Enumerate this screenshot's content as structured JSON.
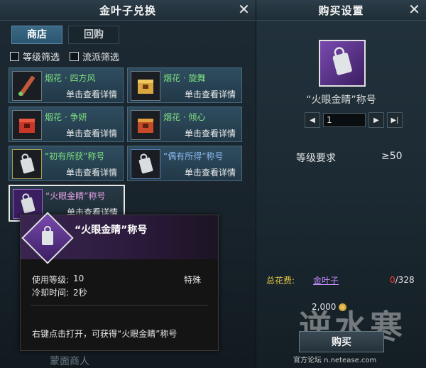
{
  "left": {
    "title": "金叶子兑换",
    "tabs": [
      {
        "label": "商店"
      },
      {
        "label": "回购"
      }
    ],
    "filters": [
      {
        "label": "等级筛选"
      },
      {
        "label": "流派筛选"
      }
    ],
    "items": [
      {
        "name": "烟花 · 四方风",
        "detail": "单击查看详情"
      },
      {
        "name": "烟花 · 旋舞",
        "detail": "单击查看详情"
      },
      {
        "name": "烟花 · 争妍",
        "detail": "单击查看详情"
      },
      {
        "name": "烟花 · 倾心",
        "detail": "单击查看详情"
      },
      {
        "name": "“初有所获”称号",
        "detail": "单击查看详情"
      },
      {
        "name": "“偶有所得”称号",
        "detail": "单击查看详情"
      },
      {
        "name": "“火眼金睛”称号",
        "detail": "单击查看详情"
      }
    ],
    "footer": "蒙面商人"
  },
  "tooltip": {
    "title": "“火眼金睛”称号",
    "level_label": "使用等级:",
    "level_value": "10",
    "type": "特殊",
    "cooldown_label": "冷却时间:",
    "cooldown_value": "2秒",
    "description": "右键点击打开，可获得“火眼金睛”称号"
  },
  "right": {
    "title": "购买设置",
    "item_name": "“火眼金睛”称号",
    "quantity": "1",
    "req_label": "等级要求",
    "req_value": "≥50",
    "cost_label": "总花费:",
    "currency": "金叶子",
    "cost_have": "0",
    "cost_total": "/328",
    "balance": "2,000",
    "buy_label": "购买",
    "footer": "官方论坛 n.netease.com",
    "watermark": "逆水寒"
  }
}
